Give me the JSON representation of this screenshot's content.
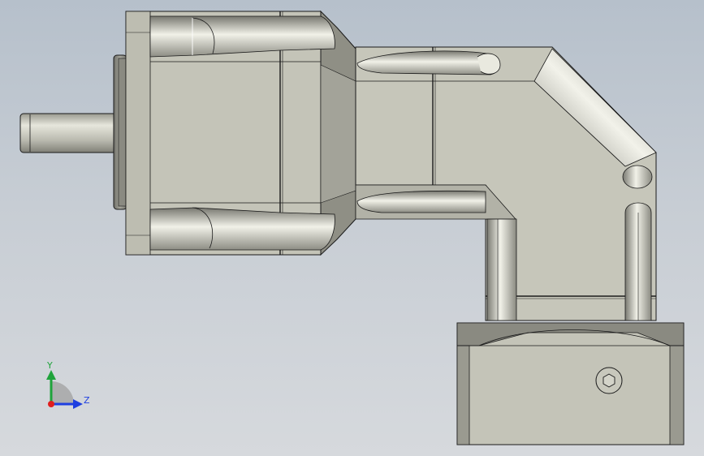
{
  "viewport": {
    "background_top": "#b6c0cb",
    "background_bottom": "#d6d9dd",
    "model_fill": "#c3c3b7",
    "model_shadow": "#8f8f85",
    "model_edge": "#1a1a1a"
  },
  "triad": {
    "y_label": "Y",
    "z_label": "Z",
    "y_color": "#1fa33b",
    "z_color": "#1e3fe0",
    "x_color": "#e01e1e"
  }
}
